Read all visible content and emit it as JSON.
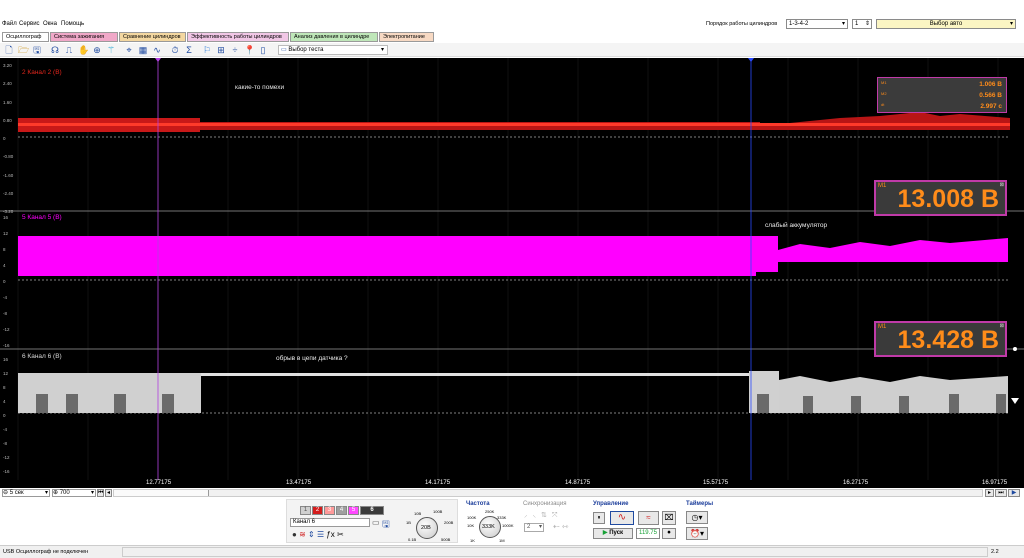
{
  "menu": [
    "Файл",
    "Сервис",
    "Окна",
    "Помощь"
  ],
  "cylinder_order": {
    "label": "Порядок работы цилиндров",
    "value": "1-3-4-2",
    "cyl": "1",
    "auto": "Выбор авто"
  },
  "tabs": [
    {
      "label": "Осциллограф",
      "color": "#ffffff"
    },
    {
      "label": "Система зажигания",
      "color": "#f0a8c8"
    },
    {
      "label": "Сравнение цилиндров",
      "color": "#f3d7a0"
    },
    {
      "label": "Эффективность работы цилиндров",
      "color": "#f1c7e6"
    },
    {
      "label": "Анализ давления в цилиндре",
      "color": "#bfe7b9"
    },
    {
      "label": "Электропитание",
      "color": "#f7d9c3"
    }
  ],
  "toolbar": {
    "test_select": "Выбор теста"
  },
  "channels": [
    {
      "label": "2 Канал 2 (В)",
      "color": "#e0261c",
      "ticks": [
        "3.20",
        "2.40",
        "1.60",
        "0.80",
        "0",
        "-0.80",
        "-1.60",
        "-2.40",
        "-3.20"
      ]
    },
    {
      "label": "5 Канал 5 (В)",
      "color": "#ff00ff",
      "ticks": [
        "16",
        "12",
        "8",
        "4",
        "0",
        "-4",
        "-8",
        "-12",
        "-16"
      ]
    },
    {
      "label": "6 Канал 6 (В)",
      "color": "#d8d8d8",
      "ticks": [
        "16",
        "12",
        "8",
        "4",
        "0",
        "-4",
        "-8",
        "-12",
        "-16"
      ]
    }
  ],
  "annotations": {
    "ch2": "какие-то помехи",
    "ch5": "слабый аккумулятор",
    "ch6": "обрыв в цепи датчика ?"
  },
  "measure": {
    "m1": "1.006 В",
    "m2": "0.566 В",
    "dt": "2.997 с",
    "m1_label": "M1",
    "m2_label": "M2",
    "dt_label": "dt"
  },
  "big_readouts": [
    {
      "tag": "M1",
      "value": "13.008 В"
    },
    {
      "tag": "M1",
      "value": "13.428 В"
    }
  ],
  "x_ticks": [
    "12.77175",
    "13.47175",
    "14.17175",
    "14.87175",
    "15.57175",
    "16.27175",
    "16.97175"
  ],
  "timebase": {
    "span": "5 сек",
    "points": "700"
  },
  "channel_panel": {
    "selected": "Канал 6",
    "ch_buttons": [
      "1",
      "2",
      "3",
      "4",
      "5",
      "6"
    ]
  },
  "groups": {
    "frequency": "Частота",
    "sync": "Синхронизация",
    "control": "Управление",
    "timers": "Таймеры"
  },
  "dial1": {
    "labels": [
      "10В",
      "100В",
      "1В",
      "200В",
      "0.1В",
      "500В"
    ],
    "value": "20В"
  },
  "dial2": {
    "labels": [
      "250K",
      "100K",
      "333K",
      "10K",
      "1000K",
      "1K",
      "1M"
    ],
    "value": "333K"
  },
  "sync_value": "2",
  "run": {
    "label": "Пуск",
    "value": "119.75"
  },
  "status": {
    "left": "USB Осциллограф не подключен",
    "right": "2.2"
  }
}
